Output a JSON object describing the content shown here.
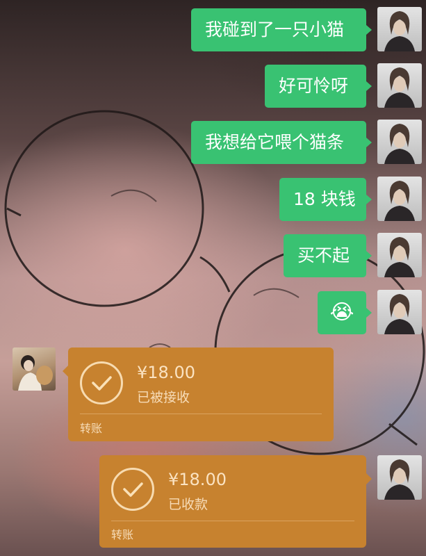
{
  "messages": [
    {
      "side": "me",
      "type": "text",
      "text": "我碰到了一只小猫"
    },
    {
      "side": "me",
      "type": "text",
      "text": "好可怜呀"
    },
    {
      "side": "me",
      "type": "text",
      "text": "我想给它喂个猫条"
    },
    {
      "side": "me",
      "type": "text",
      "text": "18 块钱"
    },
    {
      "side": "me",
      "type": "text",
      "text": "买不起"
    },
    {
      "side": "me",
      "type": "emoji",
      "text": "😭",
      "icon": "crying-emoji"
    }
  ],
  "transfers": [
    {
      "side": "other",
      "amount": "¥18.00",
      "status": "已被接收",
      "label": "转账"
    },
    {
      "side": "me",
      "amount": "¥18.00",
      "status": "已收款",
      "label": "转账"
    }
  ],
  "colors": {
    "my_bubble": "#39c272",
    "transfer_bubble": "#c7822f"
  }
}
